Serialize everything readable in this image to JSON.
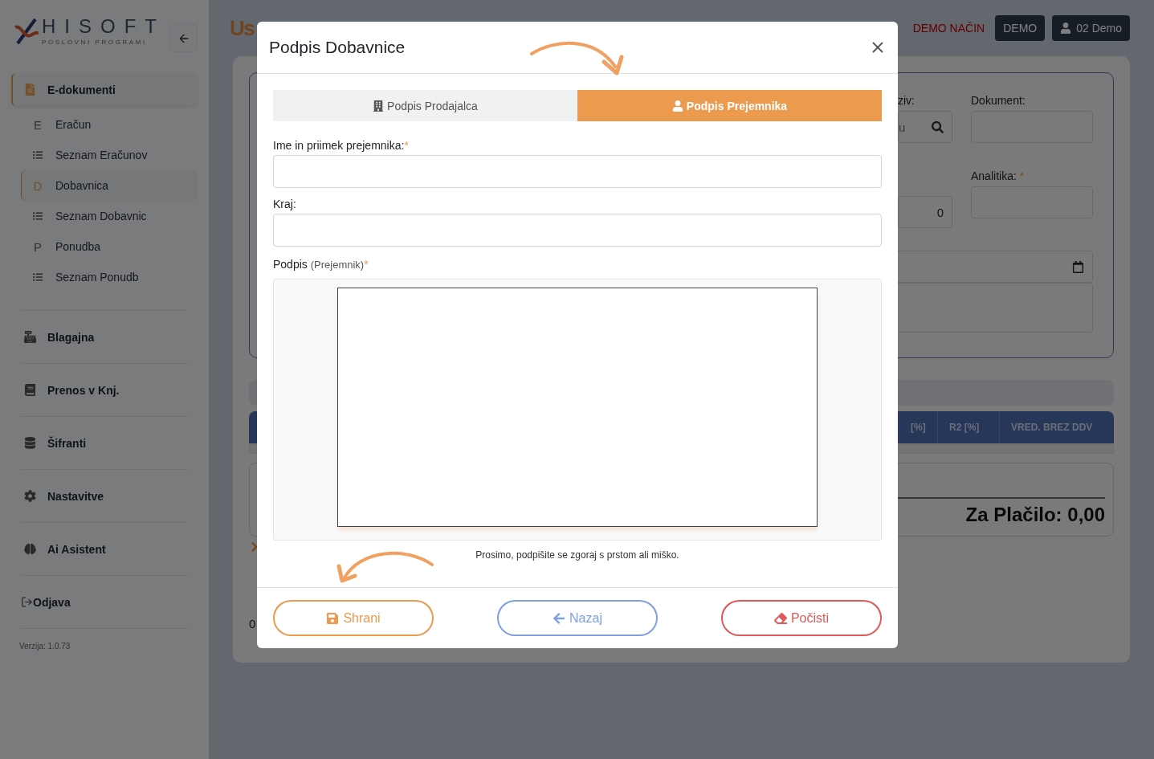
{
  "sidebar": {
    "logo": {
      "name": "HISOFT",
      "tagline": "POSLOVNI PROGRAMI"
    },
    "sections": [
      {
        "label": "E-dokumenti",
        "kind": "menu",
        "selected": true,
        "children": [
          {
            "label": "Eračun",
            "kind": "letter",
            "letter": "E",
            "selected": false
          },
          {
            "label": "Seznam Eračunov",
            "kind": "list",
            "selected": false
          },
          {
            "label": "Dobavnica",
            "kind": "letter",
            "letter": "D",
            "selected": true
          },
          {
            "label": "Seznam Dobavnic",
            "kind": "list",
            "selected": false
          },
          {
            "label": "Ponudba",
            "kind": "letter",
            "letter": "P",
            "selected": false
          },
          {
            "label": "Seznam Ponudb",
            "kind": "list",
            "selected": false
          }
        ]
      },
      {
        "label": "Blagajna",
        "kind": "menu",
        "selected": false
      },
      {
        "label": "Prenos v Knj.",
        "kind": "menu",
        "selected": false
      },
      {
        "label": "Šifranti",
        "kind": "menu",
        "selected": false
      },
      {
        "label": "Nastavitve",
        "kind": "menu",
        "selected": false
      },
      {
        "label": "Ai Asistent",
        "kind": "menu",
        "selected": false
      },
      {
        "label": "Odjava",
        "kind": "logout"
      }
    ],
    "version": "Verzija: 1.0.73"
  },
  "header": {
    "title": "Us",
    "demo_mode": "DEMO NAČIN",
    "demo_button": "DEMO",
    "user_button": "02 Demo"
  },
  "form": {
    "search_label": "ziv:",
    "search_placeholder": "u",
    "number_value": "0",
    "document_label": "Dokument:",
    "analytics_label": "Analitika:",
    "analytics_required_mark": "*"
  },
  "table": {
    "columns": [
      "[%]",
      "R2 [%]",
      "VRED. BREZ DDV"
    ]
  },
  "totals": {
    "label": "Za Plačilo: 0,00"
  },
  "footer_value": "0",
  "modal": {
    "title": "Podpis Dobavnice",
    "tabs": [
      {
        "label": "Podpis Prodajalca",
        "selected": false
      },
      {
        "label": "Podpis Prejemnika",
        "selected": true
      }
    ],
    "fields": [
      {
        "label": "Ime in priimek prejemnika:",
        "required_mark": "*"
      },
      {
        "label": "Kraj:"
      }
    ],
    "signature": {
      "label": "Podpis",
      "note": "(Prejemnik)",
      "required_mark": "*",
      "hint": "Prosimo, podpišite se zgoraj s prstom ali miško."
    },
    "buttons": [
      {
        "label": "Shrani",
        "kind": "save"
      },
      {
        "label": "Nazaj",
        "kind": "back"
      },
      {
        "label": "Počisti",
        "kind": "clear"
      }
    ]
  }
}
